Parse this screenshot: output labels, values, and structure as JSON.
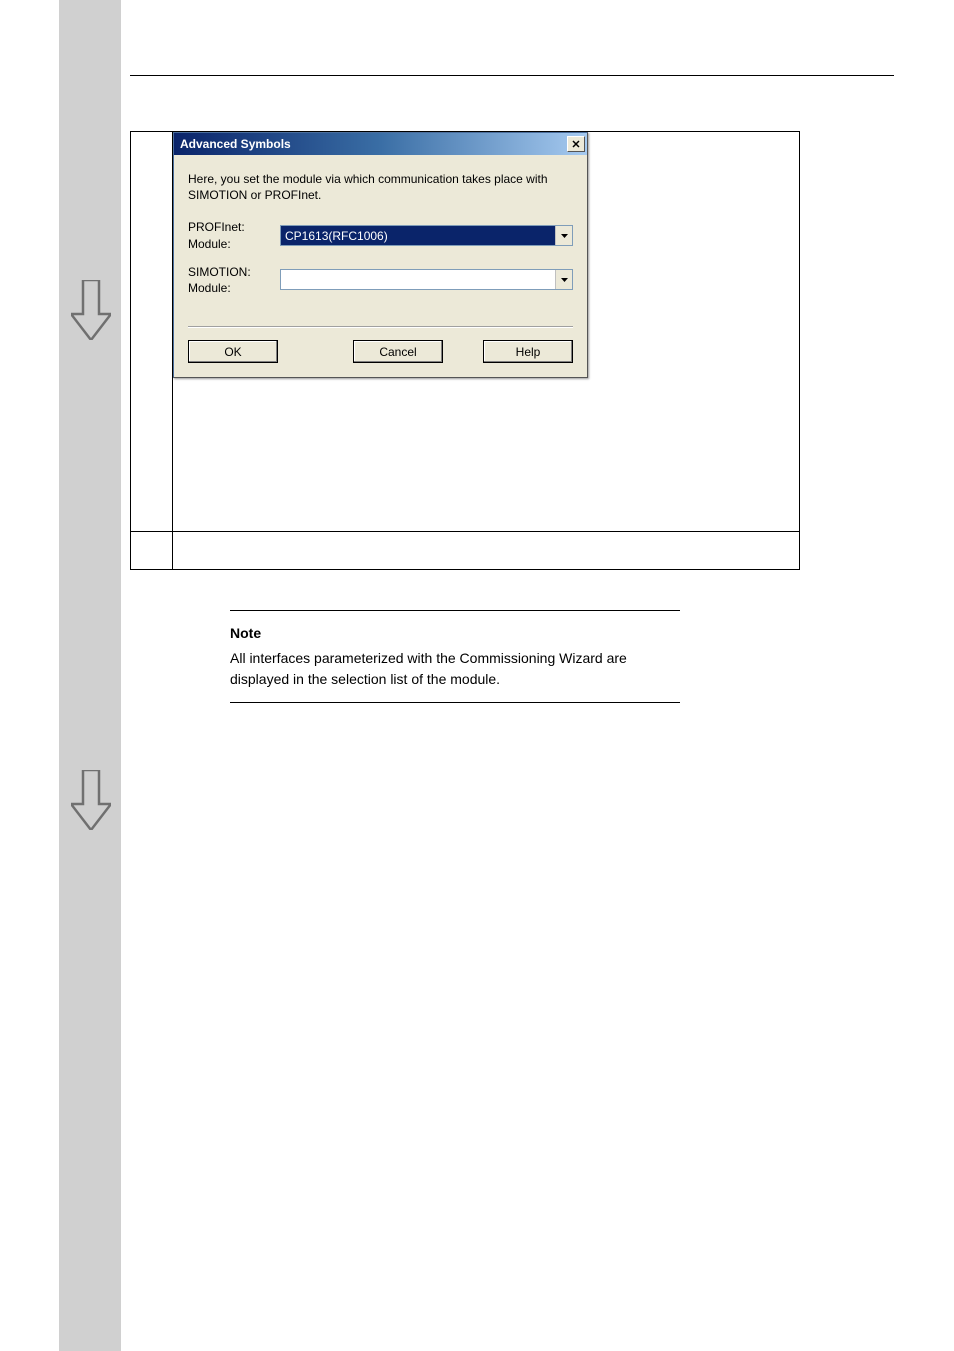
{
  "dialog": {
    "title": "Advanced Symbols",
    "description": "Here, you set the module via which communication takes place with SIMOTION or PROFInet.",
    "profinet_label_line1": "PROFInet:",
    "profinet_label_line2": "Module:",
    "profinet_value": "CP1613(RFC1006)",
    "simotion_label_line1": "SIMOTION:",
    "simotion_label_line2": "Module:",
    "simotion_value": "",
    "ok_label": "OK",
    "cancel_label": "Cancel",
    "help_label": "Help",
    "close_glyph": "✕"
  },
  "note": {
    "title": "Note",
    "body": "All interfaces parameterized with the Commissioning Wizard are displayed in the selection list of the module."
  }
}
